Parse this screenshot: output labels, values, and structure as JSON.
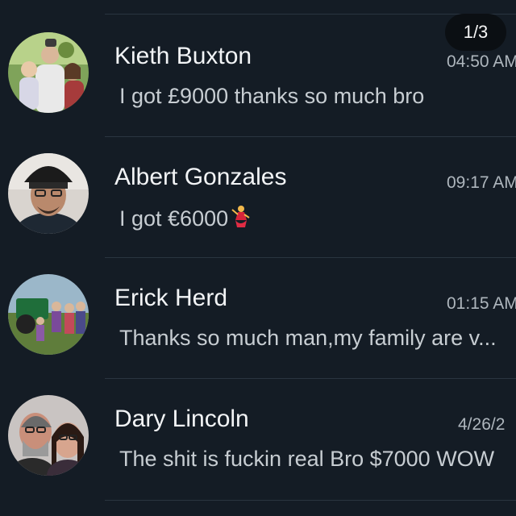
{
  "page_badge": "1/3",
  "chats": [
    {
      "name": "Kieth Buxton",
      "time": "04:50 AM",
      "message": "I got £9000 thanks so much bro",
      "avatar": "avatar-photo-family"
    },
    {
      "name": "Albert Gonzales",
      "time": "09:17 AM",
      "message": "I got €6000",
      "emoji": "dancer-emoji",
      "avatar": "avatar-photo-man-cap"
    },
    {
      "name": "Erick Herd",
      "time": "01:15 AM",
      "message": "Thanks so much man,my family are v...",
      "avatar": "avatar-photo-group-tractor"
    },
    {
      "name": "Dary Lincoln",
      "time": "4/26/2",
      "message": "The shit is fuckin real Bro $7000 WOW",
      "avatar": "avatar-photo-couple"
    }
  ],
  "colors": {
    "background": "#141c25",
    "divider": "#2a3540",
    "name_text": "#f2f4f6",
    "message_text": "#c7cdd2",
    "time_text": "#aeb6bd",
    "badge_background": "#0b0f13"
  }
}
